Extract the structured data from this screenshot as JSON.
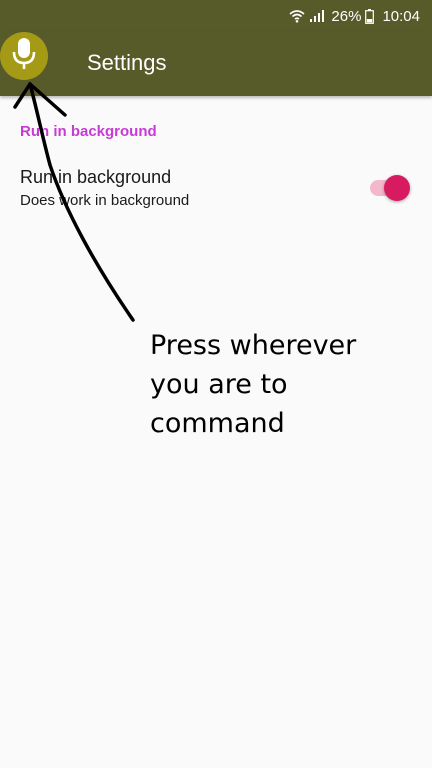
{
  "status_bar": {
    "battery_percent": "26%",
    "time": "10:04",
    "icons": [
      "wifi-icon",
      "signal-icon",
      "battery-icon"
    ]
  },
  "app_bar": {
    "title": "Settings",
    "mic_icon": "microphone-icon"
  },
  "preferences": {
    "category_title": "Run in background",
    "items": [
      {
        "title": "Run in background",
        "summary": "Does work in background",
        "switch_on": true
      }
    ]
  },
  "annotation": {
    "lines": [
      "Press wherever",
      "you are to",
      "command"
    ],
    "arrow_icon": "hand-drawn-arrow"
  },
  "colors": {
    "app_bar": "#575b2a",
    "mic_button": "#a49a16",
    "category_accent": "#c83ad8",
    "switch_thumb": "#d81b60",
    "switch_track": "#f3b8cc",
    "background": "#fafafa"
  }
}
